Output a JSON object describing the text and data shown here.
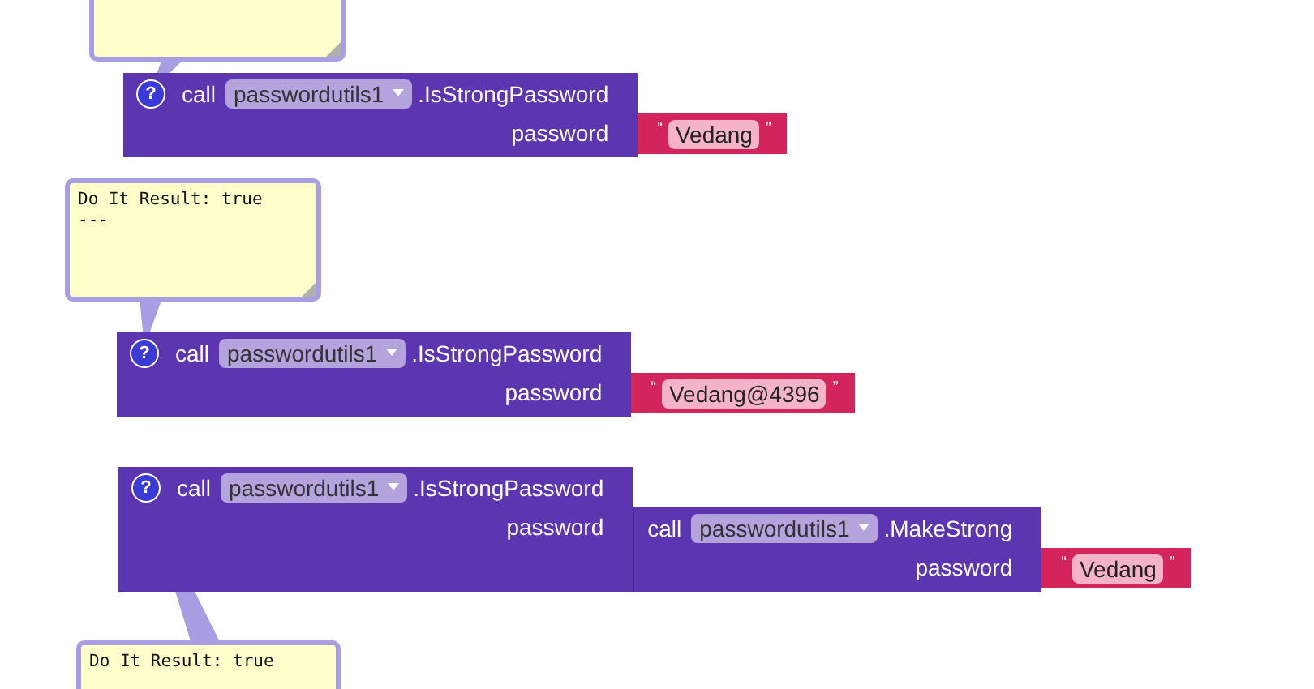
{
  "blocks": [
    {
      "bubble": {
        "open": true
      },
      "help": "?",
      "keyword": "call",
      "component": "passwordutils1",
      "method": ".IsStrongPassword",
      "param": "password",
      "arg": {
        "kind": "text",
        "open_quote": "“",
        "value": "Vedang",
        "close_quote": "”"
      }
    },
    {
      "bubble": {
        "open": true,
        "lines": [
          "Do It Result: true",
          "---"
        ]
      },
      "help": "?",
      "keyword": "call",
      "component": "passwordutils1",
      "method": ".IsStrongPassword",
      "param": "password",
      "arg": {
        "kind": "text",
        "open_quote": "“",
        "value": "Vedang@4396",
        "close_quote": "”"
      }
    },
    {
      "bubble": {
        "open": true,
        "lines": [
          "Do It Result: true"
        ]
      },
      "help": "?",
      "keyword": "call",
      "component": "passwordutils1",
      "method": ".IsStrongPassword",
      "param": "password",
      "arg": {
        "kind": "call",
        "keyword": "call",
        "component": "passwordutils1",
        "method": ".MakeStrong",
        "param": "password",
        "arg": {
          "kind": "text",
          "open_quote": "“",
          "value": "Vedang",
          "close_quote": "”"
        }
      }
    }
  ]
}
